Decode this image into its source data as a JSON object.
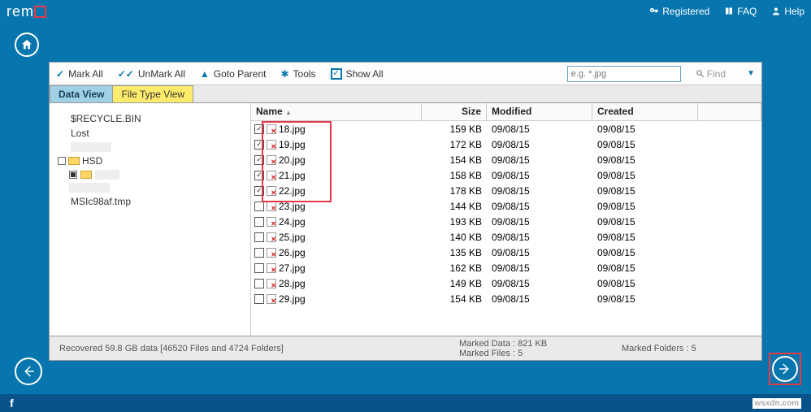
{
  "header": {
    "logo_text": "rem",
    "registered": "Registered",
    "faq": "FAQ",
    "help": "Help"
  },
  "toolbar": {
    "mark_all": "Mark All",
    "unmark_all": "UnMark All",
    "goto_parent": "Goto Parent",
    "tools": "Tools",
    "show_all": "Show All",
    "search_placeholder": "e.g. *.jpg",
    "find": "Find"
  },
  "tabs": {
    "data_view": "Data View",
    "file_type_view": "File Type View"
  },
  "tree": {
    "recycle": "$RECYCLE.BIN",
    "lost": "Lost",
    "hsd": "HSD",
    "tmp": "MSIc98af.tmp"
  },
  "columns": {
    "name": "Name",
    "size": "Size",
    "modified": "Modified",
    "created": "Created"
  },
  "files": [
    {
      "checked": true,
      "name": "18.jpg",
      "size": "159 KB",
      "modified": "09/08/15",
      "created": "09/08/15"
    },
    {
      "checked": true,
      "name": "19.jpg",
      "size": "172 KB",
      "modified": "09/08/15",
      "created": "09/08/15"
    },
    {
      "checked": true,
      "name": "20.jpg",
      "size": "154 KB",
      "modified": "09/08/15",
      "created": "09/08/15"
    },
    {
      "checked": true,
      "name": "21.jpg",
      "size": "158 KB",
      "modified": "09/08/15",
      "created": "09/08/15"
    },
    {
      "checked": true,
      "name": "22.jpg",
      "size": "178 KB",
      "modified": "09/08/15",
      "created": "09/08/15"
    },
    {
      "checked": false,
      "name": "23.jpg",
      "size": "144 KB",
      "modified": "09/08/15",
      "created": "09/08/15"
    },
    {
      "checked": false,
      "name": "24.jpg",
      "size": "193 KB",
      "modified": "09/08/15",
      "created": "09/08/15"
    },
    {
      "checked": false,
      "name": "25.jpg",
      "size": "140 KB",
      "modified": "09/08/15",
      "created": "09/08/15"
    },
    {
      "checked": false,
      "name": "26.jpg",
      "size": "135 KB",
      "modified": "09/08/15",
      "created": "09/08/15"
    },
    {
      "checked": false,
      "name": "27.jpg",
      "size": "162 KB",
      "modified": "09/08/15",
      "created": "09/08/15"
    },
    {
      "checked": false,
      "name": "28.jpg",
      "size": "149 KB",
      "modified": "09/08/15",
      "created": "09/08/15"
    },
    {
      "checked": false,
      "name": "29.jpg",
      "size": "154 KB",
      "modified": "09/08/15",
      "created": "09/08/15"
    }
  ],
  "status": {
    "recovered": "Recovered 59.8 GB data [46520 Files and 4724 Folders]",
    "marked_data": "Marked Data : 821 KB",
    "marked_files": "Marked Files : 5",
    "marked_folders": "Marked Folders : 5"
  },
  "footer": {
    "fb": "f",
    "watermark": "wsxdn.com"
  }
}
